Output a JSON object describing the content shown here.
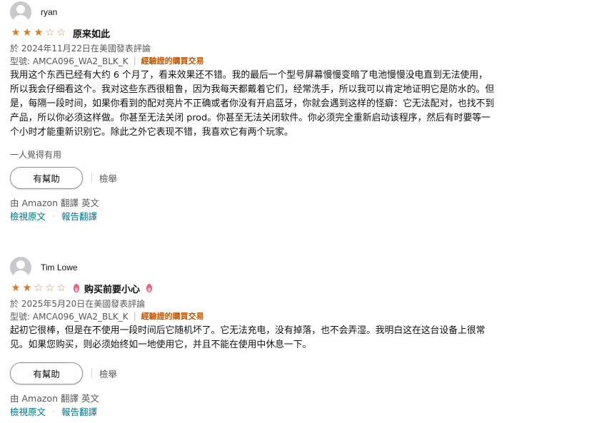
{
  "reviews": [
    {
      "reviewer": "ryan",
      "rating": 3,
      "rating_max": 5,
      "title": "原来如此",
      "date_line": "於 2024年11月22日在美國發表評論",
      "variant": "型號: AMCA096_WA2_BLK_K",
      "verified": "經驗證的購買交易",
      "body": "我用这个东西已经有大约 6 个月了，看来效果还不错。我的最后一个型号屏幕慢慢变暗了电池慢慢没电直到无法使用，所以我会仔细看这个。我对这些东西很粗鲁，因为我每天都戴着它们，经常洗手，所以我可以肯定地证明它是防水的。但是，每隔一段时间，如果你看到的配对亮片不正确或者你没有开启蓝牙，你就会遇到这样的怪癖：它无法配对，也找不到产品，所以你必须这样做。你甚至无法关闭 prod。你甚至无法关闭软件。你必须完全重新启动该程序，然后有时要等一个小时才能重新识别它。除此之外它表现不错，我喜欢它有两个玩家。",
      "helpful_count": "一人覺得有用",
      "helpful_button": "有幫助",
      "report": "檢舉",
      "translated_by": "由 Amazon 翻譯 英文",
      "view_original": "檢視原文",
      "report_translation": "報告翻譯"
    },
    {
      "reviewer": "Tim Lowe",
      "rating": 2,
      "rating_max": 5,
      "title": "购买前要小心",
      "date_line": "於 2025年5月20日在美國發表評論",
      "variant": "型號: AMCA096_WA2_BLK_K",
      "verified": "經驗證的購買交易",
      "body": "起初它很棒，但是在不使用一段时间后它随机坏了。它无法充电，没有掉落，也不会弄湿。我明白这在这台设备上很常见。如果您购买，则必须始终如一地使用它，并且不能在使用中休息一下。",
      "helpful_button": "有幫助",
      "report": "檢舉",
      "translated_by": "由 Amazon 翻譯 英文",
      "view_original": "檢視原文",
      "report_translation": "報告翻譯"
    }
  ],
  "colors": {
    "star": "#de7921",
    "verified": "#c45500",
    "link": "#007185",
    "muted": "#565959"
  }
}
